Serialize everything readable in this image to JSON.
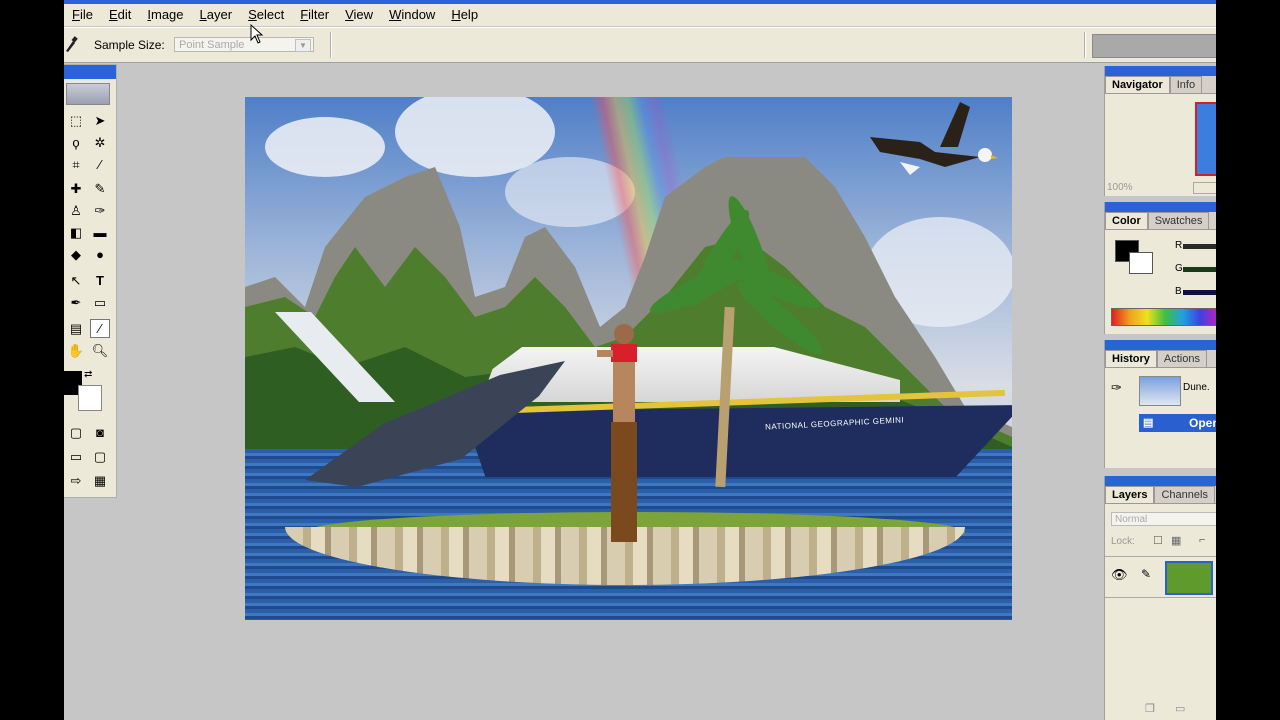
{
  "menubar": {
    "items": [
      "File",
      "Edit",
      "Image",
      "Layer",
      "Select",
      "Filter",
      "View",
      "Window",
      "Help"
    ]
  },
  "options": {
    "sample_size_label": "Sample Size:",
    "sample_size_value": "Point Sample"
  },
  "canvas": {
    "ship_name": "NATIONAL GEOGRAPHIC GEMINI"
  },
  "panels": {
    "navigator": {
      "tabs": [
        "Navigator",
        "Info"
      ],
      "zoom": "100%"
    },
    "color": {
      "tabs": [
        "Color",
        "Swatches"
      ],
      "channels": [
        "R",
        "G",
        "B"
      ],
      "foreground": "#000000",
      "background": "#ffffff"
    },
    "history": {
      "tabs": [
        "History",
        "Actions"
      ],
      "snapshot_name": "Dune.",
      "step_label": "Open"
    },
    "layers": {
      "tabs": [
        "Layers",
        "Channels"
      ],
      "blend_mode": "Normal",
      "lock_label": "Lock:"
    }
  },
  "colors": {
    "accent": "#2a63d6",
    "chrome": "#ece9d8",
    "workspace": "#c6c6c6"
  }
}
